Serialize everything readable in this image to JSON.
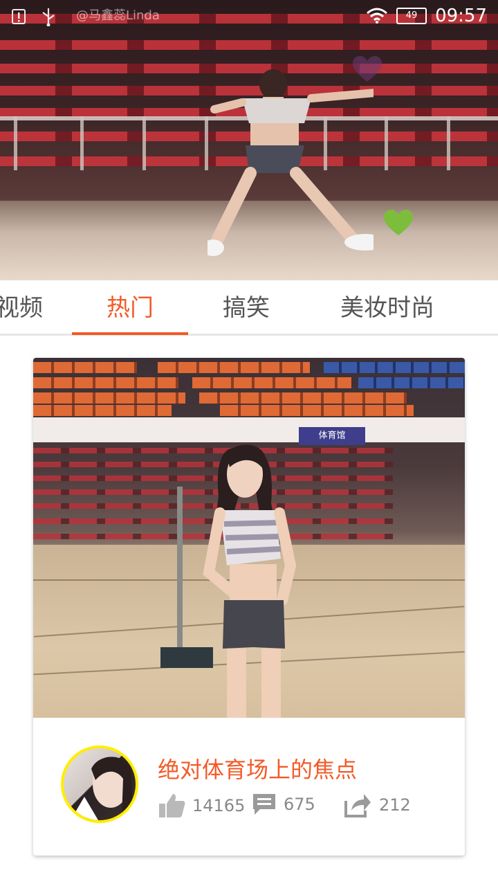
{
  "status_bar": {
    "left_icons": [
      "alert-icon",
      "usb-icon"
    ],
    "watermark": "@马鑫蕊Linda",
    "battery": "49",
    "time": "09:57"
  },
  "tabs": [
    {
      "label": "视频",
      "active": false
    },
    {
      "label": "热门",
      "active": true
    },
    {
      "label": "搞笑",
      "active": false
    },
    {
      "label": "美妆时尚",
      "active": false
    }
  ],
  "card": {
    "title": "绝对体育场上的焦点",
    "likes": "14165",
    "comments": "675",
    "shares": "212",
    "banner_text": "体育馆"
  },
  "colors": {
    "accent": "#f25a27",
    "avatar_ring": "#ffee00",
    "stat_gray": "#888888"
  }
}
